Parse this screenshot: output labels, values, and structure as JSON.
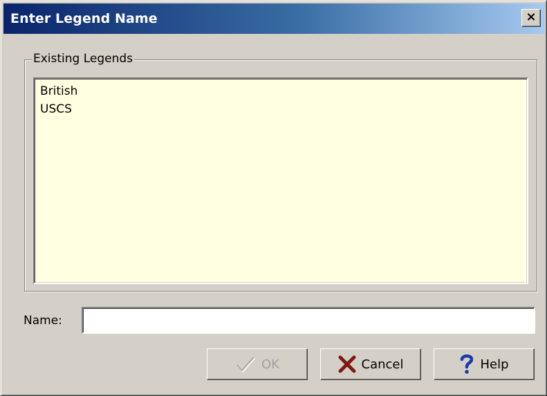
{
  "window": {
    "title": "Enter Legend Name",
    "close_label": "×"
  },
  "group": {
    "legend": "Existing Legends",
    "items": [
      "British",
      "USCS"
    ]
  },
  "name_field": {
    "label": "Name:",
    "value": ""
  },
  "buttons": {
    "ok": "OK",
    "cancel": "Cancel",
    "help": "Help"
  },
  "colors": {
    "title_gradient_start": "#0a246a",
    "title_gradient_end": "#a6caf0",
    "listbox_background": "#ffffe1",
    "dialog_background": "#d4d0c8",
    "cancel_icon": "#7a1a12",
    "help_icon": "#1a3aa8"
  },
  "icons": {
    "ok": "checkmark-icon",
    "cancel": "x-icon",
    "help": "question-icon"
  }
}
